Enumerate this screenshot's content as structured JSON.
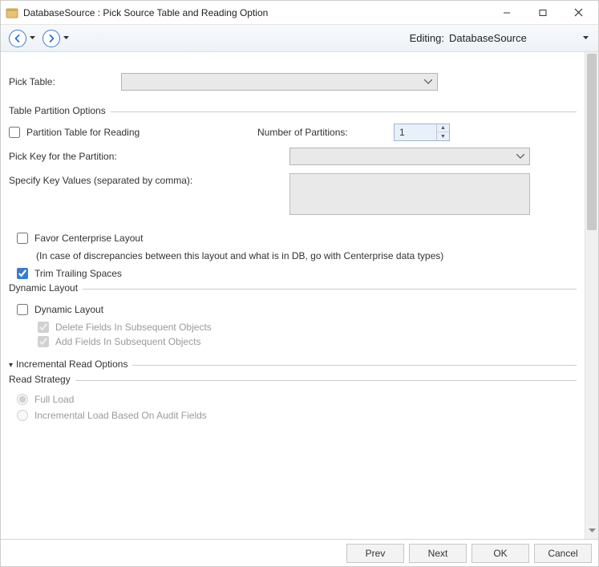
{
  "window": {
    "title": "DatabaseSource : Pick Source Table and Reading Option"
  },
  "toolbar": {
    "editing_label": "Editing:",
    "editing_value": "DatabaseSource"
  },
  "content": {
    "pick_table_label": "Pick Table:",
    "partition": {
      "legend": "Table Partition Options",
      "partition_for_reading": "Partition Table for Reading",
      "num_partitions_label": "Number of Partitions:",
      "num_partitions_value": "1",
      "pick_key_label": "Pick Key for the Partition:",
      "specify_key_label": "Specify Key Values (separated by comma):"
    },
    "favor_layout": "Favor Centerprise Layout",
    "favor_hint": "(In case of discrepancies between this layout and what is in DB, go with Centerprise data types)",
    "trim_trailing": "Trim Trailing Spaces",
    "dynamic": {
      "legend": "Dynamic Layout",
      "dynamic_layout": "Dynamic Layout",
      "delete_fields": "Delete Fields In Subsequent Objects",
      "add_fields": "Add Fields In Subsequent Objects"
    },
    "incremental": {
      "legend": "Incremental Read Options",
      "strategy_legend": "Read Strategy",
      "full_load": "Full Load",
      "incremental_audit": "Incremental Load Based On Audit Fields"
    }
  },
  "buttons": {
    "prev": "Prev",
    "next": "Next",
    "ok": "OK",
    "cancel": "Cancel"
  }
}
